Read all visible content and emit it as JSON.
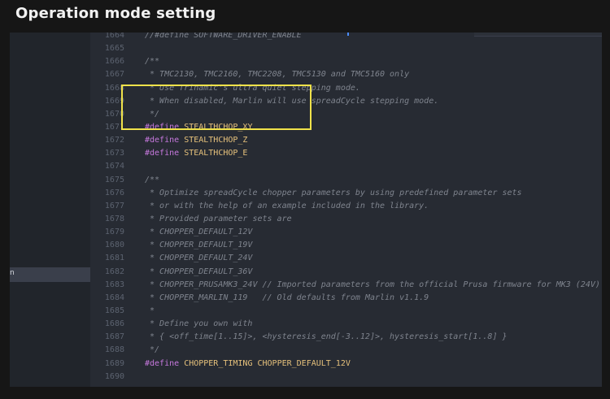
{
  "header": {
    "title": "Operation mode setting"
  },
  "sidebar": {
    "selected_label": "n"
  },
  "colors": {
    "highlight": "#f0e24a",
    "keyword": "#c678dd",
    "macro": "#e5c07b",
    "comment": "#7f848e"
  },
  "code": {
    "lines": [
      {
        "num": "1664",
        "text": "//#define SOFTWARE_DRIVER_ENABLE",
        "kind": "comment"
      },
      {
        "num": "1665",
        "text": "",
        "kind": "plain"
      },
      {
        "num": "1666",
        "text": "/**",
        "kind": "comment"
      },
      {
        "num": "1667",
        "text": " * TMC2130, TMC2160, TMC2208, TMC5130 and TMC5160 only",
        "kind": "comment"
      },
      {
        "num": "1668",
        "text": " * Use Trinamic's ultra quiet stepping mode.",
        "kind": "comment"
      },
      {
        "num": "1669",
        "text": " * When disabled, Marlin will use spreadCycle stepping mode.",
        "kind": "comment"
      },
      {
        "num": "1670",
        "text": " */",
        "kind": "comment"
      },
      {
        "num": "1671",
        "kw": "#define",
        "macro": "STEALTHCHOP_XY",
        "kind": "define"
      },
      {
        "num": "1672",
        "kw": "#define",
        "macro": "STEALTHCHOP_Z",
        "kind": "define"
      },
      {
        "num": "1673",
        "kw": "#define",
        "macro": "STEALTHCHOP_E",
        "kind": "define"
      },
      {
        "num": "1674",
        "text": "",
        "kind": "plain"
      },
      {
        "num": "1675",
        "text": "/**",
        "kind": "comment"
      },
      {
        "num": "1676",
        "text": " * Optimize spreadCycle chopper parameters by using predefined parameter sets",
        "kind": "comment"
      },
      {
        "num": "1677",
        "text": " * or with the help of an example included in the library.",
        "kind": "comment"
      },
      {
        "num": "1678",
        "text": " * Provided parameter sets are",
        "kind": "comment"
      },
      {
        "num": "1679",
        "text": " * CHOPPER_DEFAULT_12V",
        "kind": "comment"
      },
      {
        "num": "1680",
        "text": " * CHOPPER_DEFAULT_19V",
        "kind": "comment"
      },
      {
        "num": "1681",
        "text": " * CHOPPER_DEFAULT_24V",
        "kind": "comment"
      },
      {
        "num": "1682",
        "text": " * CHOPPER_DEFAULT_36V",
        "kind": "comment"
      },
      {
        "num": "1683",
        "text": " * CHOPPER_PRUSAMK3_24V // Imported parameters from the official Prusa firmware for MK3 (24V)",
        "kind": "comment"
      },
      {
        "num": "1684",
        "text": " * CHOPPER_MARLIN_119   // Old defaults from Marlin v1.1.9",
        "kind": "comment"
      },
      {
        "num": "1685",
        "text": " *",
        "kind": "comment"
      },
      {
        "num": "1686",
        "text": " * Define you own with",
        "kind": "comment"
      },
      {
        "num": "1687",
        "text": " * { <off_time[1..15]>, <hysteresis_end[-3..12]>, hysteresis_start[1..8] }",
        "kind": "comment"
      },
      {
        "num": "1688",
        "text": " */",
        "kind": "comment"
      },
      {
        "num": "1689",
        "kw": "#define",
        "macro": "CHOPPER_TIMING CHOPPER_DEFAULT_12V",
        "kind": "define"
      },
      {
        "num": "1690",
        "text": "",
        "kind": "plain"
      }
    ]
  }
}
